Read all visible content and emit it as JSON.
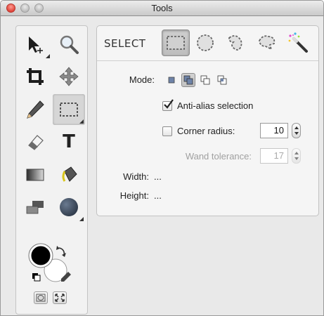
{
  "window": {
    "title": "Tools"
  },
  "tools": [
    {
      "name": "move-selection-tool",
      "icon": "arrow-move-icon"
    },
    {
      "name": "zoom-tool",
      "icon": "magnifier-icon"
    },
    {
      "name": "crop-tool",
      "icon": "crop-icon"
    },
    {
      "name": "pan-tool",
      "icon": "move-arrows-icon"
    },
    {
      "name": "pencil-tool",
      "icon": "pencil-icon"
    },
    {
      "name": "selection-tool",
      "icon": "marquee-icon",
      "selected": true
    },
    {
      "name": "eraser-tool",
      "icon": "eraser-icon"
    },
    {
      "name": "text-tool",
      "icon": "text-icon"
    },
    {
      "name": "gradient-tool",
      "icon": "gradient-icon"
    },
    {
      "name": "paint-bucket-tool",
      "icon": "paint-bucket-icon"
    },
    {
      "name": "layer-tool",
      "icon": "layers-icon"
    },
    {
      "name": "shape-tool",
      "icon": "circle-icon"
    }
  ],
  "text_tool_glyph": "T",
  "color_well": {
    "foreground": "#000000",
    "background": "#ffffff"
  },
  "panel": {
    "header": "SELECT",
    "shape_modes": [
      "rectangle-select-icon",
      "ellipse-select-icon",
      "lasso-select-icon",
      "polygon-lasso-select-icon",
      "magic-wand-icon"
    ],
    "mode_label": "Mode:",
    "anti_alias": {
      "label": "Anti-alias selection",
      "checked": true
    },
    "corner_radius": {
      "label": "Corner radius:",
      "value": "10",
      "checked": false
    },
    "wand_tolerance": {
      "label": "Wand tolerance:",
      "value": "17"
    },
    "width_label": "Width:",
    "width_value": "...",
    "height_label": "Height:",
    "height_value": "..."
  },
  "colors": {
    "accent": "#3b7fd7",
    "shape_fill": "#e0e0e0"
  }
}
